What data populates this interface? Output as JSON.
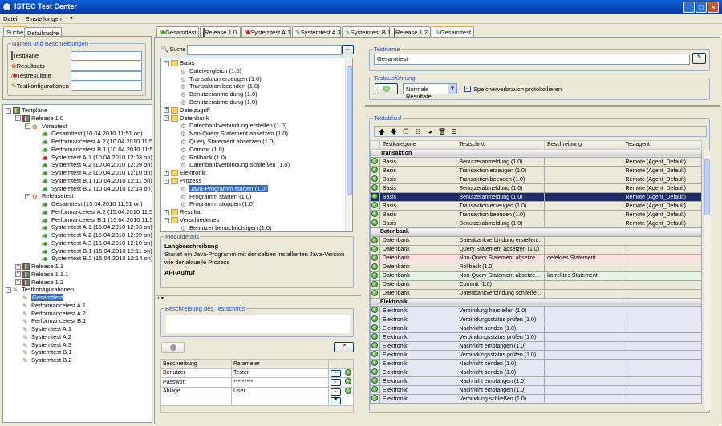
{
  "window": {
    "title": "ISTEC Test Center",
    "menu": [
      "Datei",
      "Einstellungen",
      "?"
    ]
  },
  "left": {
    "tabs": [
      "Suche",
      "Detailsuche"
    ],
    "group_label": "Namen und Beschreibungen",
    "fields": [
      "Testpläne",
      "Resultsets",
      "Testresultate",
      "Testkonfigurationen"
    ],
    "tree": [
      {
        "l": 0,
        "t": "Testpläne",
        "e": "-",
        "i": "plan"
      },
      {
        "l": 1,
        "t": "Release 1.0",
        "e": "-",
        "i": "plan"
      },
      {
        "l": 2,
        "t": "Vorabtest",
        "e": "-",
        "i": "rs"
      },
      {
        "l": 3,
        "t": "Gesamttest (10.04.2010 11:51 on)",
        "i": "ok"
      },
      {
        "l": 3,
        "t": "Performancetest A.2 (10.04.2010 11:53 on)",
        "i": "ok"
      },
      {
        "l": 3,
        "t": "Performancetest B.1 (10.04.2010 11:59 on)",
        "i": "ok"
      },
      {
        "l": 3,
        "t": "Systemtest A.1 (10.04.2010 12:03 on)",
        "i": "fail"
      },
      {
        "l": 3,
        "t": "Systemtest A.2 (10.04.2010 12:09 on)",
        "i": "ok"
      },
      {
        "l": 3,
        "t": "Systemtest A.3 (10.04.2010 12:10 on)",
        "i": "ok"
      },
      {
        "l": 3,
        "t": "Systemtest B.1 (10.04.2010 12:11 on)",
        "i": "ok"
      },
      {
        "l": 3,
        "t": "Systemtest B.2 (10.04.2010 12:14 on)",
        "i": "ok"
      },
      {
        "l": 2,
        "t": "Releasetest",
        "e": "-",
        "i": "rs"
      },
      {
        "l": 3,
        "t": "Gesamttest (15.04.2010 11:51 on)",
        "i": "ok"
      },
      {
        "l": 3,
        "t": "Performancetest A.2 (15.04.2010 11:53 on)",
        "i": "ok"
      },
      {
        "l": 3,
        "t": "Performancetest B.1 (15.04.2010 11:59 on)",
        "i": "ok"
      },
      {
        "l": 3,
        "t": "Systemtest A.1 (15.04.2010 12:03 on)",
        "i": "ok"
      },
      {
        "l": 3,
        "t": "Systemtest A.2 (15.04.2010 12:09 on)",
        "i": "ok"
      },
      {
        "l": 3,
        "t": "Systemtest A.3 (15.04.2010 12:10 on)",
        "i": "ok"
      },
      {
        "l": 3,
        "t": "Systemtest B.1 (15.04.2010 12:11 on)",
        "i": "ok"
      },
      {
        "l": 3,
        "t": "Systemtest B.2 (15.04.2010 12:14 on)",
        "i": "ok"
      },
      {
        "l": 1,
        "t": "Release 1.1",
        "e": "+",
        "i": "plan"
      },
      {
        "l": 1,
        "t": "Release 1.1.1",
        "e": "+",
        "i": "plan"
      },
      {
        "l": 1,
        "t": "Release 1.2",
        "e": "+",
        "i": "plan"
      },
      {
        "l": 0,
        "t": "Testkonfigurationen",
        "e": "-",
        "i": "cfg"
      },
      {
        "l": 1,
        "t": "Gesamttest",
        "i": "cfg",
        "s": true
      },
      {
        "l": 1,
        "t": "Performancetest A.1",
        "i": "cfg"
      },
      {
        "l": 1,
        "t": "Performancetest A.2",
        "i": "cfg"
      },
      {
        "l": 1,
        "t": "Performancetest B.1",
        "i": "cfg"
      },
      {
        "l": 1,
        "t": "Systemtest A.1",
        "i": "cfg"
      },
      {
        "l": 1,
        "t": "Systemtest A.2",
        "i": "cfg"
      },
      {
        "l": 1,
        "t": "Systemtest A.3",
        "i": "cfg"
      },
      {
        "l": 1,
        "t": "Systemtest B.1",
        "i": "cfg"
      },
      {
        "l": 1,
        "t": "Systemtest B.2",
        "i": "cfg"
      }
    ]
  },
  "doc_tabs": [
    {
      "t": "Gesamttest",
      "i": "ok"
    },
    {
      "t": "Release 1.0",
      "i": "plan"
    },
    {
      "t": "Systemtest A.1",
      "i": "fail"
    },
    {
      "t": "Systemtest A.3",
      "i": "cfg"
    },
    {
      "t": "Systemtest B.1",
      "i": "cfg"
    },
    {
      "t": "Release 1.2",
      "i": "plan"
    },
    {
      "t": "Gesamttest",
      "i": "cfg",
      "a": true
    }
  ],
  "middle": {
    "search_label": "Suche",
    "search_value": "",
    "browse": "...",
    "tree": [
      {
        "l": 0,
        "t": "Basis",
        "e": "-",
        "i": "folder"
      },
      {
        "l": 1,
        "t": "Dateivergleich (1.0)",
        "i": "gear"
      },
      {
        "l": 1,
        "t": "Transaktion erzeugen (1.0)",
        "i": "gear"
      },
      {
        "l": 1,
        "t": "Transaktion beenden (1.0)",
        "i": "gear"
      },
      {
        "l": 1,
        "t": "Benutzeranmeldung (1.0)",
        "i": "gear"
      },
      {
        "l": 1,
        "t": "Benutzerabmeldung (1.0)",
        "i": "gear"
      },
      {
        "l": 0,
        "t": "Dateizugriff",
        "e": "+",
        "i": "folder"
      },
      {
        "l": 0,
        "t": "Datenbank",
        "e": "-",
        "i": "folder"
      },
      {
        "l": 1,
        "t": "Datenbankverbindung erstellen (1.0)",
        "i": "gear"
      },
      {
        "l": 1,
        "t": "Non-Query Statement absetzen (1.0)",
        "i": "gear"
      },
      {
        "l": 1,
        "t": "Query Statement absetzen (1.0)",
        "i": "gear"
      },
      {
        "l": 1,
        "t": "Commit (1.0)",
        "i": "gear"
      },
      {
        "l": 1,
        "t": "Rollback (1.0)",
        "i": "gear"
      },
      {
        "l": 1,
        "t": "Datenbankverbindung schließen (1.0)",
        "i": "gear"
      },
      {
        "l": 0,
        "t": "Elektronik",
        "e": "+",
        "i": "folder"
      },
      {
        "l": 0,
        "t": "Prozess",
        "e": "-",
        "i": "folder"
      },
      {
        "l": 1,
        "t": "Java-Programm starten (1.0)",
        "i": "gear",
        "s": true
      },
      {
        "l": 1,
        "t": "Programm starten (1.0)",
        "i": "gear"
      },
      {
        "l": 1,
        "t": "Programm stoppen (1.0)",
        "i": "gear"
      },
      {
        "l": 0,
        "t": "Resultat",
        "e": "+",
        "i": "folder"
      },
      {
        "l": 0,
        "t": "Verschiedenes",
        "e": "-",
        "i": "folder"
      },
      {
        "l": 1,
        "t": "Benutzer benachrichtigen (1.0)",
        "i": "gear"
      }
    ],
    "module_label": "Moduldetails",
    "long_title": "Langbeschreibung",
    "long_text": "Startet ein Java-Programm mit der selben installierten Java-Version wie der aktuelle Prozess",
    "api_title": "API-Aufruf",
    "desc_label": "Beschreibung des Testschritts",
    "params": {
      "headers": [
        "Beschreibung",
        "Parameter"
      ],
      "rows": [
        [
          "Benutzer",
          "Tester"
        ],
        [
          "Passwort",
          "*********"
        ],
        [
          "Ablage",
          "User"
        ]
      ]
    }
  },
  "right": {
    "testname_label": "Testname",
    "testname": "Gesamttest",
    "exec_label": "Testausführung",
    "mode": "Normale Resultate",
    "memory_label": "Speicherverbrauch protokollieren",
    "memory_checked": true,
    "flow_label": "Testablauf",
    "toolbar": [
      "move-up",
      "move-down",
      "copy",
      "properties",
      "palette",
      "delete",
      "table"
    ],
    "headers": [
      "Testkategorie",
      "Testschritt",
      "Beschreibung",
      "Testagent"
    ],
    "rows": [
      {
        "g": "Transaktion"
      },
      {
        "c": "Basis",
        "s": "Benutzeranmeldung (1.0)",
        "d": "",
        "a": "Remote (Agent_Default)"
      },
      {
        "c": "Basis",
        "s": "Transaktion erzeugen (1.0)",
        "d": "",
        "a": "Remote (Agent_Default)"
      },
      {
        "c": "Basis",
        "s": "Transaktion beenden (1.0)",
        "d": "",
        "a": "Remote (Agent_Default)"
      },
      {
        "c": "Basis",
        "s": "Benutzerabmeldung (1.0)",
        "d": "",
        "a": "Remote (Agent_Default)"
      },
      {
        "c": "Basis",
        "s": "Benutzeranmeldung (1.0)",
        "d": "",
        "a": "Remote (Agent_Default)",
        "k": "sel"
      },
      {
        "c": "Basis",
        "s": "Transaktion erzeugen (1.0)",
        "d": "",
        "a": "Remote (Agent_Default)"
      },
      {
        "c": "Basis",
        "s": "Transaktion beenden (1.0)",
        "d": "",
        "a": "Remote (Agent_Default)"
      },
      {
        "c": "Basis",
        "s": "Benutzerabmeldung (1.0)",
        "d": "",
        "a": "Remote (Agent_Default)"
      },
      {
        "g": "Datenbank"
      },
      {
        "c": "Datenbank",
        "s": "Datenbankverbindung erstellen...",
        "d": "",
        "a": ""
      },
      {
        "c": "Datenbank",
        "s": "Query Statement absetzen (1.0)",
        "d": "",
        "a": ""
      },
      {
        "c": "Datenbank",
        "s": "Non-Query Statement absetze...",
        "d": "defektes Statement",
        "a": "",
        "k": "err"
      },
      {
        "c": "Datenbank",
        "s": "Rollback (1.0)",
        "d": "",
        "a": ""
      },
      {
        "c": "Datenbank",
        "s": "Non-Query Statement absetze...",
        "d": "korrektes Statement",
        "a": "",
        "k": "ok"
      },
      {
        "c": "Datenbank",
        "s": "Commit (1.0)",
        "d": "",
        "a": ""
      },
      {
        "c": "Datenbank",
        "s": "Datenbankverbindung schließe...",
        "d": "",
        "a": ""
      },
      {
        "g": "Elektronik"
      },
      {
        "c": "Elektronik",
        "s": "Verbindung herstellen (1.0)",
        "d": "",
        "a": "",
        "k": "el"
      },
      {
        "c": "Elektronik",
        "s": "Verbindungsstatus prüfen (1.0)",
        "d": "",
        "a": "",
        "k": "el"
      },
      {
        "c": "Elektronik",
        "s": "Nachricht senden (1.0)",
        "d": "",
        "a": "",
        "k": "el"
      },
      {
        "c": "Elektronik",
        "s": "Verbindungsstatus prüfen (1.0)",
        "d": "",
        "a": "",
        "k": "el"
      },
      {
        "c": "Elektronik",
        "s": "Nachricht empfangen (1.0)",
        "d": "",
        "a": "",
        "k": "el"
      },
      {
        "c": "Elektronik",
        "s": "Verbindungsstatus prüfen (1.0)",
        "d": "",
        "a": "",
        "k": "el"
      },
      {
        "c": "Elektronik",
        "s": "Nachricht senden (1.0)",
        "d": "",
        "a": "",
        "k": "el"
      },
      {
        "c": "Elektronik",
        "s": "Nachricht senden (1.0)",
        "d": "",
        "a": "",
        "k": "el"
      },
      {
        "c": "Elektronik",
        "s": "Nachricht empfangen (1.0)",
        "d": "",
        "a": "",
        "k": "el"
      },
      {
        "c": "Elektronik",
        "s": "Nachricht empfangen (1.0)",
        "d": "",
        "a": "",
        "k": "el"
      },
      {
        "c": "Elektronik",
        "s": "Verbindung schließen (1.0)",
        "d": "",
        "a": "",
        "k": "el"
      }
    ]
  },
  "colors": {
    "accent": "#316ac5",
    "selected_row": "#1d2d6a",
    "error_row": "#fde0e0",
    "ok_row": "#e4f7e4",
    "group_label": "#1c4fc0"
  }
}
